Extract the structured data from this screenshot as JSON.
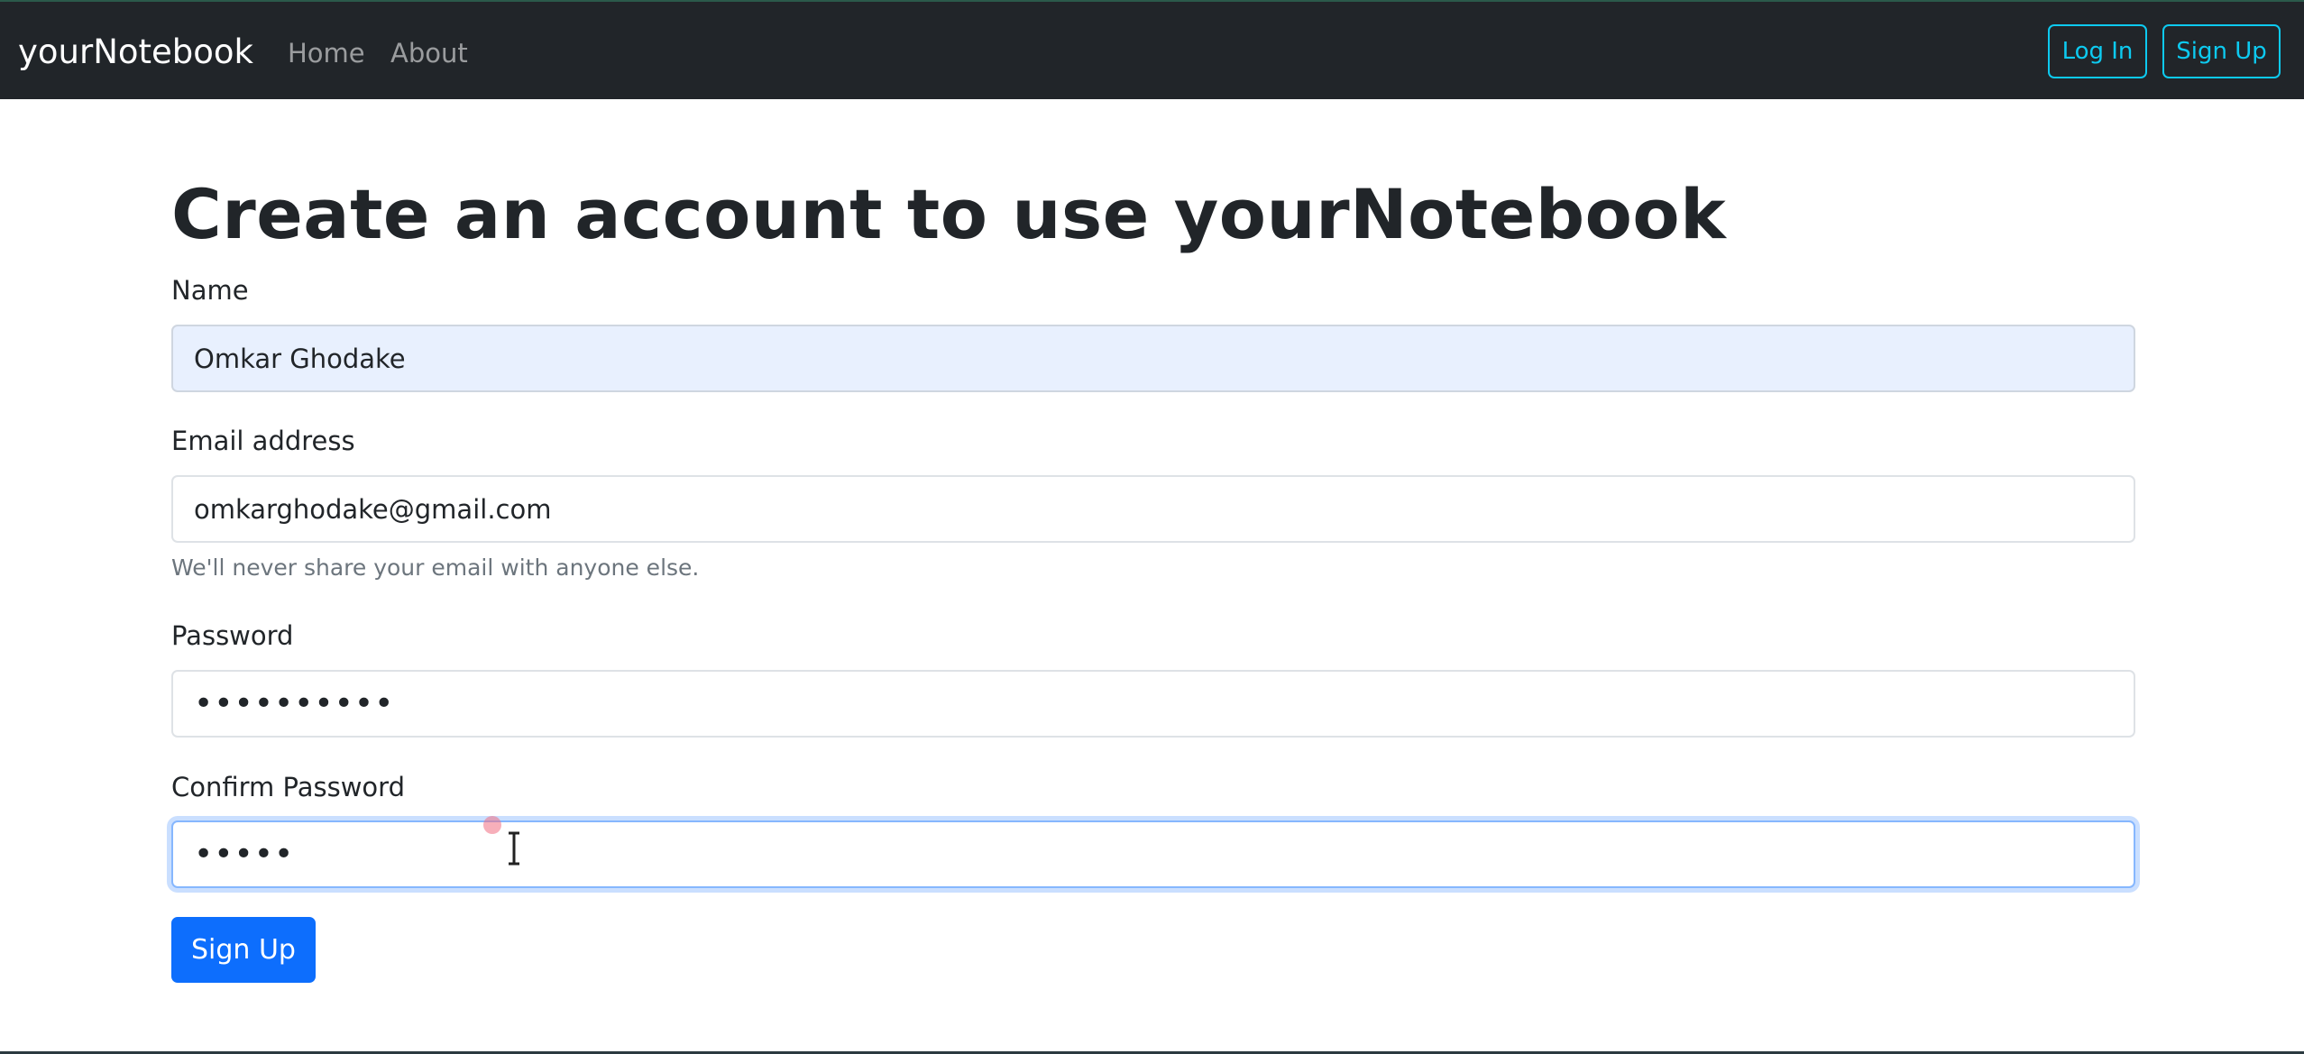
{
  "navbar": {
    "brand": "yourNotebook",
    "links": [
      {
        "label": "Home"
      },
      {
        "label": "About"
      }
    ],
    "buttons": {
      "login_label": "Log In",
      "signup_label": "Sign Up"
    },
    "colors": {
      "background": "#212529",
      "outline_button": "#0dcaf0"
    }
  },
  "main": {
    "title": "Create an account to use yourNotebook",
    "form": {
      "name": {
        "label": "Name",
        "value": "Omkar Ghodake"
      },
      "email": {
        "label": "Email address",
        "value": "omkarghodake@gmail.com",
        "help_text": "We'll never share your email with anyone else."
      },
      "password": {
        "label": "Password",
        "value": "••••••••••"
      },
      "confirm_password": {
        "label": "Confirm Password",
        "value": "•••••"
      },
      "submit_label": "Sign Up"
    },
    "colors": {
      "primary": "#0d6efd",
      "muted_text": "#6c757d",
      "focus_ring": "#86b7fe"
    }
  }
}
